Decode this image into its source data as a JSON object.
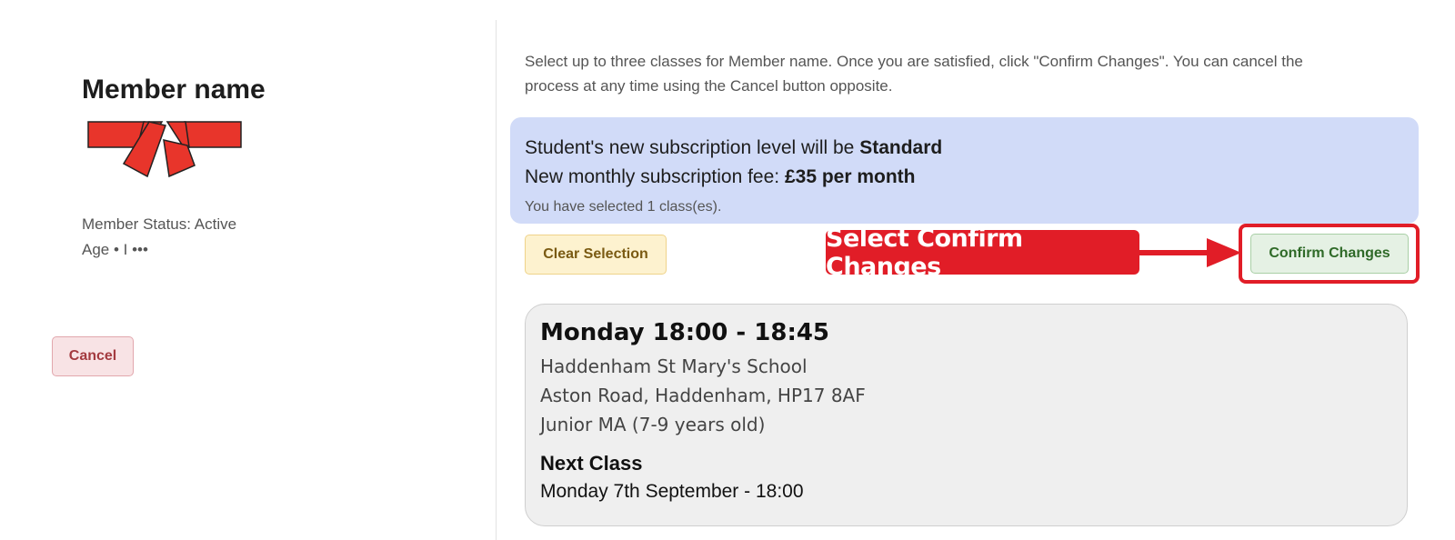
{
  "member": {
    "name": "Member name",
    "status": "Member Status: Active",
    "age": "Age • I •••"
  },
  "left_actions": {
    "cancel_label": "Cancel"
  },
  "instructions": "Select up to three classes for Member name. Once you are satisfied, click \"Confirm Changes\". You can cancel the process at any time using the Cancel button opposite.",
  "subscription": {
    "level_prefix": "Student's new subscription level will be ",
    "level_value": "Standard",
    "fee_prefix": "New monthly subscription fee: ",
    "fee_value": "£35 per month",
    "selected_text": "You have selected 1 class(es)."
  },
  "actions": {
    "clear_label": "Clear Selection",
    "confirm_label": "Confirm Changes"
  },
  "annotation": {
    "label": "Select Confirm Changes",
    "color": "#e11d27"
  },
  "selected_class": {
    "title": "Monday 18:00 - 18:45",
    "venue": "Haddenham St Mary's School",
    "address": "Aston Road, Haddenham, HP17 8AF",
    "group": "Junior MA (7-9 years old)",
    "next_label": "Next Class",
    "next_value": "Monday 7th September - 18:00"
  },
  "colors": {
    "info_bg": "#d1dbf8",
    "belt_red": "#e8352b"
  },
  "icons": {
    "belt": "karate-belt-icon",
    "arrow": "arrow-right-icon"
  }
}
